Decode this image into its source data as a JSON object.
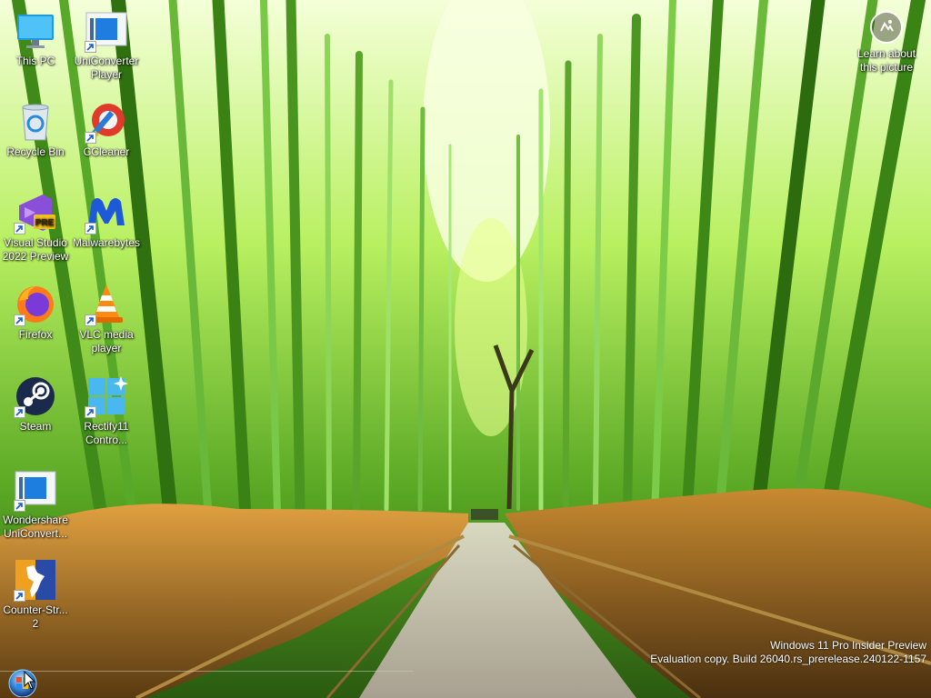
{
  "desktop": {
    "icons": [
      {
        "label": "This PC",
        "icon": "this-pc-icon",
        "shortcut": false
      },
      {
        "label": "UniConverter Player",
        "icon": "uniconverter-player-icon",
        "shortcut": true
      },
      {
        "label": "Recycle Bin",
        "icon": "recycle-bin-icon",
        "shortcut": false
      },
      {
        "label": "CCleaner",
        "icon": "ccleaner-icon",
        "shortcut": true
      },
      {
        "label": "Visual Studio 2022 Preview",
        "icon": "visual-studio-icon",
        "shortcut": true
      },
      {
        "label": "Malwarebytes",
        "icon": "malwarebytes-icon",
        "shortcut": true
      },
      {
        "label": "Firefox",
        "icon": "firefox-icon",
        "shortcut": true
      },
      {
        "label": "VLC media player",
        "icon": "vlc-icon",
        "shortcut": true
      },
      {
        "label": "Steam",
        "icon": "steam-icon",
        "shortcut": true
      },
      {
        "label": "Rectify11 Contro...",
        "icon": "rectify11-icon",
        "shortcut": true
      },
      {
        "label": "Wondershare UniConvert...",
        "icon": "wondershare-uniconverter-icon",
        "shortcut": true
      },
      {
        "label": "Counter-Str... 2",
        "icon": "counter-strike-icon",
        "shortcut": true
      }
    ],
    "learn_about": {
      "label": "Learn about this picture",
      "icon": "camera-icon"
    }
  },
  "watermark": {
    "line1": "Windows 11 Pro Insider Preview",
    "line2": "Evaluation copy. Build 26040.rs_prerelease.240122-1157"
  },
  "taskbar": {
    "start_icon": "start-orb-icon"
  }
}
